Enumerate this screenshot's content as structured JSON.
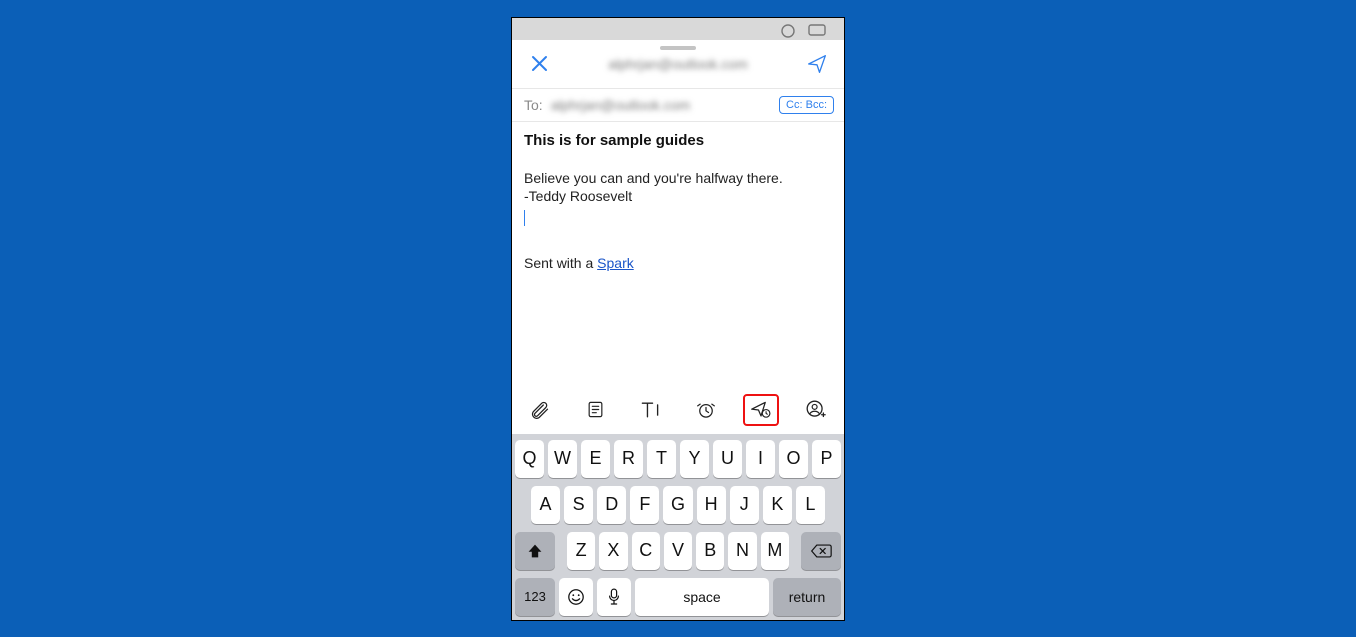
{
  "colors": {
    "accent": "#2f80ed",
    "highlight_border": "#e11",
    "bg": "#0b5fb7"
  },
  "header": {
    "from_account": "alphrjan@outlook.com"
  },
  "to": {
    "label": "To:",
    "value": "alphrjan@outlook.com",
    "ccbcc": "Cc: Bcc:"
  },
  "subject": "This is for sample guides",
  "body": {
    "line1": "Believe you can and you're halfway there.",
    "line2": "-Teddy Roosevelt",
    "sig_prefix": "Sent with a ",
    "sig_link": "Spark"
  },
  "toolbar_icons": [
    "attachment",
    "template",
    "text-format",
    "reminder",
    "send-later",
    "add-person"
  ],
  "highlighted_toolbar_index": 4,
  "keyboard": {
    "row1": [
      "Q",
      "W",
      "E",
      "R",
      "T",
      "Y",
      "U",
      "I",
      "O",
      "P"
    ],
    "row2": [
      "A",
      "S",
      "D",
      "F",
      "G",
      "H",
      "J",
      "K",
      "L"
    ],
    "row3": [
      "Z",
      "X",
      "C",
      "V",
      "B",
      "N",
      "M"
    ],
    "key123": "123",
    "space": "space",
    "return": "return"
  }
}
